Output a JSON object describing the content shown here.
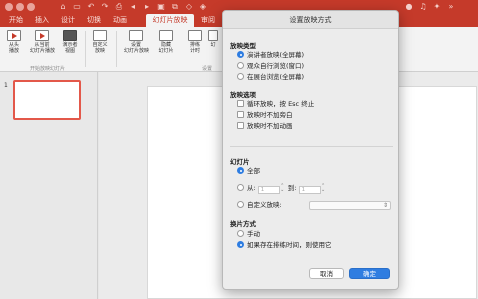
{
  "ribbon_tabs": [
    "开始",
    "插入",
    "设计",
    "切换",
    "动画",
    "幻灯片放映",
    "审阅"
  ],
  "active_tab": "幻灯片放映",
  "ribbon": {
    "buttons": [
      {
        "label": "从头\n播放"
      },
      {
        "label": "从当前\n幻灯片播放"
      },
      {
        "label": "演示者\n视图"
      },
      {
        "label": "自定义\n放映"
      },
      {
        "label": "设置\n幻灯片放映"
      },
      {
        "label": "隐藏\n幻灯片"
      },
      {
        "label": "排练\n计时"
      },
      {
        "label": "幻"
      }
    ],
    "group_label_start": "开始放映幻灯片",
    "group_label_settings": "设置"
  },
  "thumbnail": {
    "slide_number": "1"
  },
  "dialog": {
    "title": "设置放映方式",
    "show_type": {
      "heading": "放映类型",
      "options": [
        "演讲者放映(全屏幕)",
        "观众自行浏览(窗口)",
        "在展台浏览(全屏幕)"
      ],
      "selected": 0
    },
    "show_options": {
      "heading": "放映选项",
      "checkboxes": [
        "循环放映，按 Esc 终止",
        "放映时不加旁白",
        "放映时不加动画"
      ]
    },
    "slides": {
      "heading": "幻灯片",
      "all_label": "全部",
      "from_label": "从:",
      "from_value": "1",
      "to_label": "到:",
      "to_value": "1",
      "custom_label": "自定义放映:"
    },
    "advance": {
      "heading": "换片方式",
      "options": [
        "手动",
        "如果存在排练时间，则使用它"
      ],
      "selected": 1
    },
    "cancel_label": "取消",
    "ok_label": "确定"
  },
  "colors": {
    "accent": "#c53a2a",
    "primary_button": "#2f7de1"
  }
}
